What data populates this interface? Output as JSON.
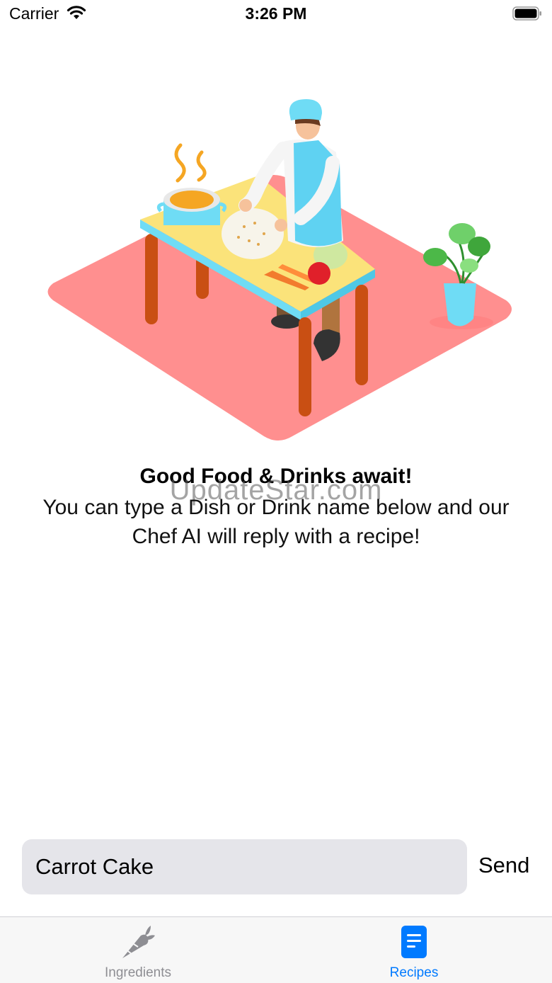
{
  "status_bar": {
    "carrier": "Carrier",
    "time": "3:26 PM"
  },
  "hero": {
    "illustration": "chef-cooking-illustration"
  },
  "welcome": {
    "headline": "Good Food & Drinks await!",
    "body": "You can type a Dish or Drink name below and our Chef AI will reply with a recipe!",
    "watermark": "UpdateStar.com"
  },
  "composer": {
    "input_value": "Carrot Cake",
    "send_label": "Send"
  },
  "tab_bar": {
    "tabs": [
      {
        "label": "Ingredients",
        "icon": "carrot-icon",
        "selected": false
      },
      {
        "label": "Recipes",
        "icon": "document-icon",
        "selected": true
      }
    ]
  },
  "colors": {
    "accent": "#007aff",
    "rug": "#ff8f8f",
    "input_bg": "#e5e5ea"
  }
}
